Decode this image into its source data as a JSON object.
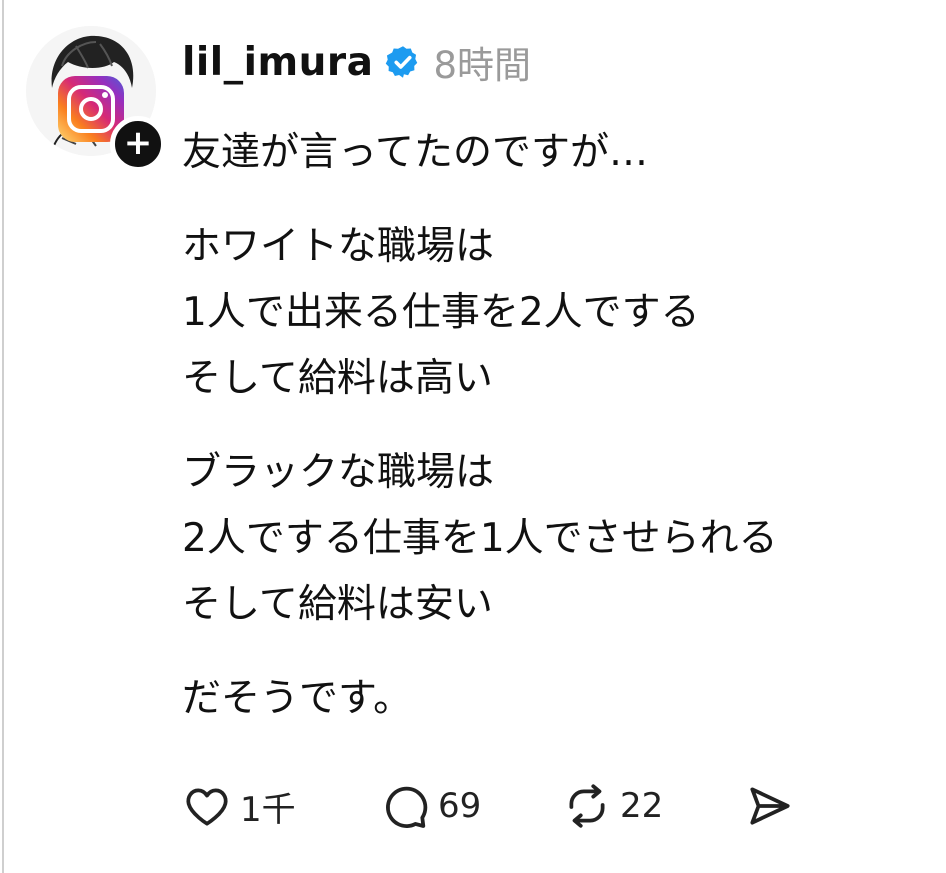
{
  "post": {
    "author": {
      "username": "lil_imura",
      "verified": true,
      "verified_icon": "verified-badge-icon",
      "avatar_icon": "instagram-logo-icon",
      "follow_icon": "plus-icon"
    },
    "time": "8時間",
    "paragraphs": [
      "友達が言ってたのですが…",
      "ホワイトな職場は\n1人で出来る仕事を2人でする\nそして給料は高い",
      "ブラックな職場は\n2人でする仕事を1人でさせられる\nそして給料は安い",
      "だそうです。"
    ],
    "actions": {
      "likes": "1千",
      "replies": "69",
      "reposts": "22"
    }
  },
  "colors": {
    "verified": "#1d9bf0",
    "time": "#9a9a9a",
    "text": "#111111"
  }
}
